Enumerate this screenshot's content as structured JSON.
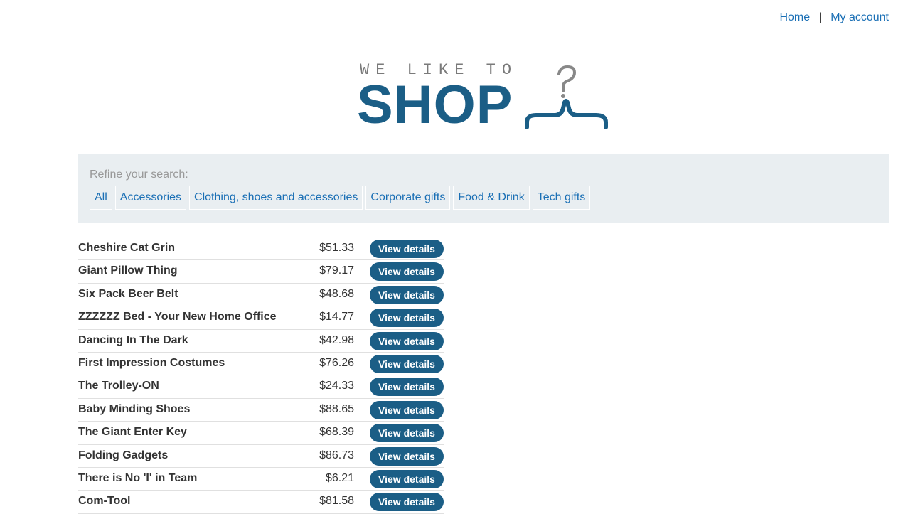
{
  "nav": {
    "home": "Home",
    "separator": "|",
    "account": "My account"
  },
  "logo": {
    "tagline": "WE LIKE TO",
    "wordmark": "SHOP",
    "icon": "hanger-icon",
    "colors": {
      "wordmark": "#1b5e86",
      "tagline": "#7a7a7a"
    }
  },
  "refine": {
    "label": "Refine your search:",
    "filters": [
      "All",
      "Accessories",
      "Clothing, shoes and accessories",
      "Corporate gifts",
      "Food & Drink",
      "Tech gifts"
    ]
  },
  "products": [
    {
      "name": "Cheshire Cat Grin",
      "price": "$51.33",
      "button": "View details"
    },
    {
      "name": "Giant Pillow Thing",
      "price": "$79.17",
      "button": "View details"
    },
    {
      "name": "Six Pack Beer Belt",
      "price": "$48.68",
      "button": "View details"
    },
    {
      "name": "ZZZZZZ Bed - Your New Home Office",
      "price": "$14.77",
      "button": "View details"
    },
    {
      "name": "Dancing In The Dark",
      "price": "$42.98",
      "button": "View details"
    },
    {
      "name": "First Impression Costumes",
      "price": "$76.26",
      "button": "View details"
    },
    {
      "name": "The Trolley-ON",
      "price": "$24.33",
      "button": "View details"
    },
    {
      "name": "Baby Minding Shoes",
      "price": "$88.65",
      "button": "View details"
    },
    {
      "name": "The Giant Enter Key",
      "price": "$68.39",
      "button": "View details"
    },
    {
      "name": "Folding Gadgets",
      "price": "$86.73",
      "button": "View details"
    },
    {
      "name": "There is No 'I' in Team",
      "price": "$6.21",
      "button": "View details"
    },
    {
      "name": "Com-Tool",
      "price": "$81.58",
      "button": "View details"
    }
  ],
  "colors": {
    "link": "#1a6fb5",
    "button": "#1b5e86",
    "refine_bg": "#e9eef1"
  }
}
